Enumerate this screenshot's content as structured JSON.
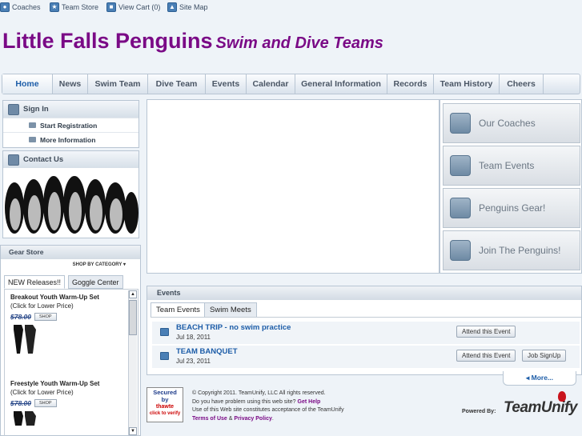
{
  "topbar": {
    "links": [
      {
        "label": "Coaches",
        "icon": "coaches-icon"
      },
      {
        "label": "Team Store",
        "icon": "store-icon"
      },
      {
        "label": "View Cart (0)",
        "icon": "cart-icon"
      },
      {
        "label": "Site Map",
        "icon": "sitemap-icon"
      }
    ]
  },
  "header": {
    "title": "Little Falls Penguins",
    "subtitle": "Swim and Dive Teams"
  },
  "nav": {
    "tabs": [
      "Home",
      "News",
      "Swim Team",
      "Dive Team",
      "Events",
      "Calendar",
      "General Information",
      "Records",
      "Team History",
      "Cheers"
    ],
    "active": "Home"
  },
  "sidebar": {
    "sign_in": "Sign In",
    "start_registration": "Start Registration",
    "more_information": "More Information",
    "contact_us": "Contact Us"
  },
  "gear_store": {
    "title": "Gear Store",
    "shop_by": "SHOP BY CATEGORY ▾",
    "tabs": [
      "NEW Releases!!",
      "Goggle Center"
    ],
    "products": [
      {
        "name": "Breakout Youth Warm-Up Set",
        "note": "(Click for Lower Price)",
        "price": "$78.00",
        "button": "SHOP"
      },
      {
        "name": "Freestyle Youth Warm-Up Set",
        "note": "(Click for Lower Price)",
        "price": "$78.00",
        "button": "SHOP"
      }
    ]
  },
  "side_buttons": [
    "Our Coaches",
    "Team Events",
    "Penguins Gear!",
    "Join The Penguins!"
  ],
  "events": {
    "title": "Events",
    "tabs": [
      "Team Events",
      "Swim Meets"
    ],
    "items": [
      {
        "name": "BEACH TRIP - no swim practice",
        "date": "Jul 18, 2011",
        "buttons": [
          "Attend this Event"
        ]
      },
      {
        "name": "TEAM BANQUET",
        "date": "Jul 23, 2011",
        "buttons": [
          "Attend this Event",
          "Job SignUp"
        ]
      }
    ],
    "more": "◂ More..."
  },
  "footer": {
    "seal_line1": "Secured",
    "seal_line2": "by",
    "seal_line3": "thawte",
    "seal_line4": "click to verify",
    "copyright": "© Copyright 2011. TeamUnify, LLC All rights reserved.",
    "problem_text": "Do you have problem using this web site? ",
    "get_help": "Get Help",
    "terms_text": "Use of this Web site constitutes acceptance of the TeamUnify",
    "terms_link": "Terms of Use",
    "and": " & ",
    "privacy_link": "Privacy Policy",
    "period": ".",
    "powered_by": "Powered By:",
    "brand": "TeamUnify"
  }
}
